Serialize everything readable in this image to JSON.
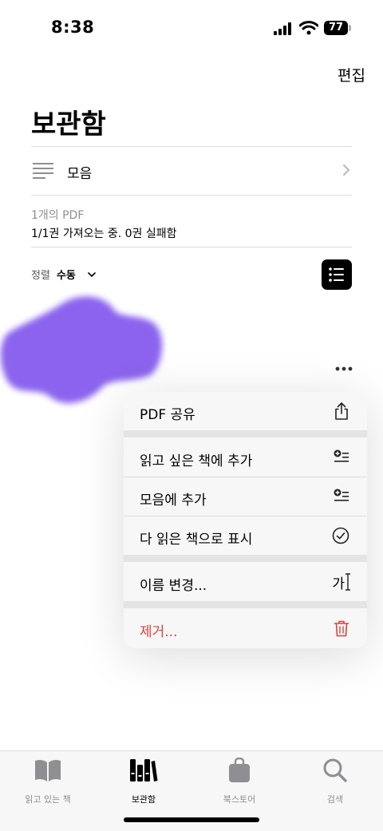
{
  "status_bar": {
    "time": "8:38",
    "battery": "77"
  },
  "header": {
    "edit_label": "편집",
    "title": "보관함"
  },
  "collection_row": {
    "label": "모음"
  },
  "summary": {
    "pdf_count": "1개의 PDF",
    "import_status": "1/1권 가져오는 중. 0권 실패함"
  },
  "sort": {
    "label": "정렬",
    "value": "수동"
  },
  "context_menu": {
    "items": [
      {
        "label": "PDF 공유",
        "icon": "share-icon"
      },
      {
        "label": "읽고 싶은 책에 추가",
        "icon": "add-to-want-to-read-icon"
      },
      {
        "label": "모음에 추가",
        "icon": "add-to-collection-icon"
      },
      {
        "label": "다 읽은 책으로 표시",
        "icon": "checkmark-circle-icon"
      },
      {
        "label": "이름 변경...",
        "icon": "rename-icon"
      },
      {
        "label": "제거...",
        "icon": "trash-icon"
      }
    ],
    "rename_glyph": "가",
    "destructive_color": "#e0403a"
  },
  "tab_bar": {
    "tabs": [
      {
        "label": "읽고 있는 책",
        "icon": "book-open-icon"
      },
      {
        "label": "보관함",
        "icon": "library-icon",
        "active": true
      },
      {
        "label": "북스토어",
        "icon": "bag-icon"
      },
      {
        "label": "검색",
        "icon": "search-icon"
      }
    ]
  }
}
